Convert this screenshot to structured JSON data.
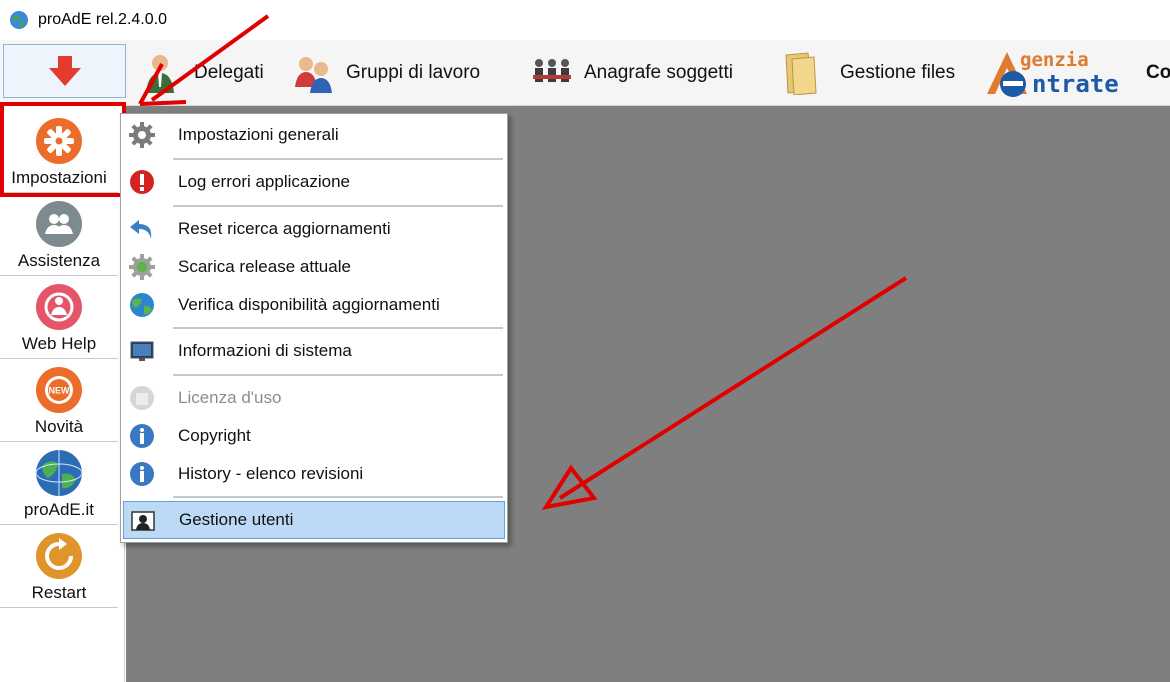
{
  "window": {
    "title": "proAdE rel.2.4.0.0",
    "app_icon": "globe-icon"
  },
  "toolbar": {
    "collapse_icon": "arrow-down-icon",
    "items": [
      {
        "label": "Delegati",
        "icon": "delegate-person-icon"
      },
      {
        "label": "Gruppi di lavoro",
        "icon": "group-people-icon"
      },
      {
        "label": "Anagrafe soggetti",
        "icon": "people-registry-icon"
      },
      {
        "label": "Gestione files",
        "icon": "folder-icon"
      }
    ],
    "logo": {
      "line1": "genzia",
      "line2": "ntrate",
      "icon": "agenzia-entrate-logo"
    },
    "truncated_label": "Co"
  },
  "sidebar": {
    "items": [
      {
        "label": "Impostazioni",
        "icon": "settings-gear-icon",
        "color": "#ec6c2a"
      },
      {
        "label": "Assistenza",
        "icon": "support-people-icon",
        "color": "#7d8a8f"
      },
      {
        "label": "Web Help",
        "icon": "web-help-icon",
        "color": "#e45569"
      },
      {
        "label": "Novità",
        "icon": "new-badge-icon",
        "color": "#ec6c2a",
        "badge": "NEW"
      },
      {
        "label": "proAdE.it",
        "icon": "globe-icon",
        "color": "#2b6cb5"
      },
      {
        "label": "Restart",
        "icon": "restart-icon",
        "color": "#e0952a"
      }
    ]
  },
  "menu": {
    "items": [
      {
        "label": "Impostazioni generali",
        "icon": "gear-icon"
      },
      {
        "label": "Log errori applicazione",
        "icon": "error-icon"
      },
      {
        "label": "Reset ricerca aggiornamenti",
        "icon": "undo-arrow-icon"
      },
      {
        "label": "Scarica release attuale",
        "icon": "download-gear-icon"
      },
      {
        "label": "Verifica disponibilità aggiornamenti",
        "icon": "globe-icon"
      },
      {
        "label": "Informazioni di sistema",
        "icon": "monitor-icon"
      },
      {
        "label": "Licenza d'uso",
        "icon": "license-icon",
        "disabled": true
      },
      {
        "label": "Copyright",
        "icon": "info-icon"
      },
      {
        "label": "History - elenco revisioni",
        "icon": "info-icon"
      },
      {
        "label": "Gestione utenti",
        "icon": "user-management-icon",
        "selected": true
      }
    ]
  },
  "colors": {
    "annotation_red": "#e00000",
    "workspace_gray": "#7f7f7f",
    "selection_blue": "#bcd9f5"
  }
}
